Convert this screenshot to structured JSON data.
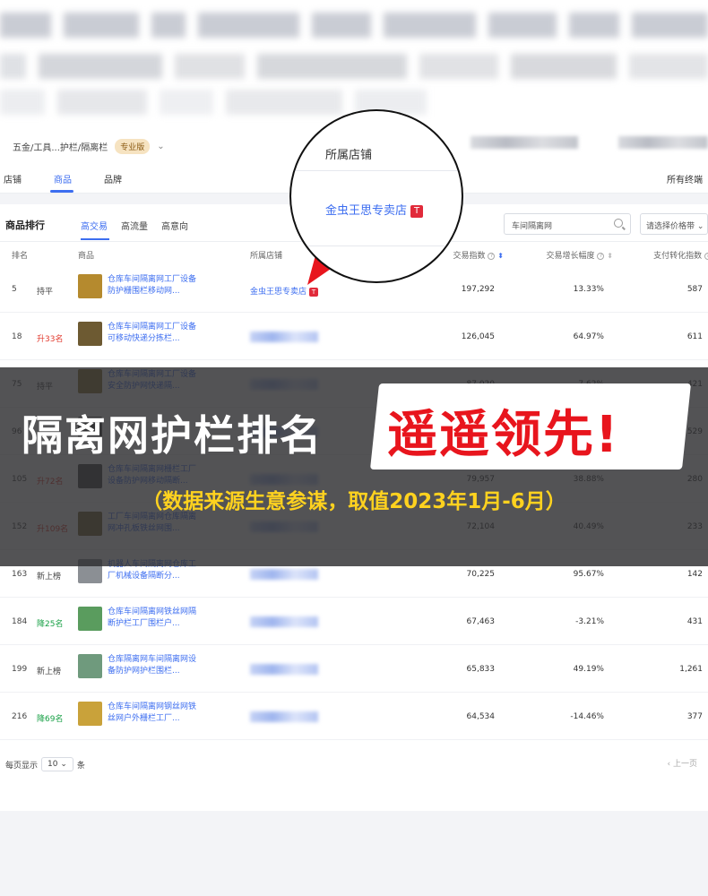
{
  "breadcrumb": {
    "path": "五金/工具...护栏/隔离栏",
    "edition": "专业版"
  },
  "top_nav": {
    "items": [
      "店铺",
      "商品",
      "品牌"
    ],
    "active": "商品",
    "right_item": "所有终端"
  },
  "section": {
    "title": "商品排行",
    "tabs": [
      "高交易",
      "高流量",
      "高意向"
    ],
    "active_tab": "高交易",
    "search_value": "车间隔离网",
    "select_value": "请选择价格带"
  },
  "table": {
    "headers": {
      "rank": "排名",
      "product": "商品",
      "shop": "所属店铺",
      "trade_index": "交易指数",
      "growth": "交易增长幅度",
      "conversion": "支付转化指数"
    },
    "rows": [
      {
        "rank": "5",
        "change": "持平",
        "trend": "flat",
        "name": "仓库车间隔离网工厂设备防护栅围栏移动网...",
        "shop": "金虫王思专卖店",
        "shop_visible": true,
        "trade_index": "197,292",
        "growth": "13.33%",
        "conversion": "587",
        "thumb_color": "#b58a2e"
      },
      {
        "rank": "18",
        "change": "升33名",
        "trend": "up",
        "name": "仓库车间隔离网工厂设备可移动快递分拣栏...",
        "shop": "",
        "shop_visible": false,
        "trade_index": "126,045",
        "growth": "64.97%",
        "conversion": "611",
        "thumb_color": "#6d5a32"
      },
      {
        "rank": "75",
        "change": "持平",
        "trend": "flat",
        "name": "仓库车间隔离网工厂设备安全防护网快递隔...",
        "shop": "",
        "shop_visible": false,
        "trade_index": "87,020",
        "growth": "7.62%",
        "conversion": "421",
        "thumb_color": "#8e7d3a"
      },
      {
        "rank": "96",
        "change": "",
        "trend": "flat",
        "name": "",
        "shop": "",
        "shop_visible": false,
        "trade_index": "",
        "growth": "",
        "conversion": "529",
        "thumb_color": "#555555"
      },
      {
        "rank": "105",
        "change": "升72名",
        "trend": "up",
        "name": "仓库车间隔离网栅栏工厂设备防护网移动隔断...",
        "shop": "",
        "shop_visible": false,
        "trade_index": "79,957",
        "growth": "38.88%",
        "conversion": "280",
        "thumb_color": "#4a4a4a"
      },
      {
        "rank": "152",
        "change": "升109名",
        "trend": "up",
        "name": "工厂车间隔离网仓库隔离网冲孔板铁丝网围...",
        "shop": "",
        "shop_visible": false,
        "trade_index": "72,104",
        "growth": "40.49%",
        "conversion": "233",
        "thumb_color": "#7a6a3a"
      },
      {
        "rank": "163",
        "change": "新上榜",
        "trend": "flat",
        "name": "机器人车间隔离网仓库工厂机械设备隔断分...",
        "shop": "",
        "shop_visible": false,
        "trade_index": "70,225",
        "growth": "95.67%",
        "conversion": "142",
        "thumb_color": "#8b8f94"
      },
      {
        "rank": "184",
        "change": "降25名",
        "trend": "down",
        "name": "仓库车间隔离网铁丝网隔断护栏工厂围栏户...",
        "shop": "",
        "shop_visible": false,
        "trade_index": "67,463",
        "growth": "-3.21%",
        "conversion": "431",
        "thumb_color": "#5a9c5e"
      },
      {
        "rank": "199",
        "change": "新上榜",
        "trend": "flat",
        "name": "仓库隔离网车间隔离网设备防护网护栏围栏...",
        "shop": "",
        "shop_visible": false,
        "trade_index": "65,833",
        "growth": "49.19%",
        "conversion": "1,261",
        "thumb_color": "#6f9a7d"
      },
      {
        "rank": "216",
        "change": "降69名",
        "trend": "down",
        "name": "仓库车间隔离网钢丝网铁丝网户外栅栏工厂...",
        "shop": "",
        "shop_visible": false,
        "trade_index": "64,534",
        "growth": "-14.46%",
        "conversion": "377",
        "thumb_color": "#c9a23a"
      }
    ]
  },
  "pager": {
    "per_page_label": "每页显示",
    "per_page": "10",
    "unit": "条",
    "prev": "‹ 上一页"
  },
  "magnifier": {
    "header": "所属店铺",
    "shop": "金虫王思专卖店",
    "badge": "T"
  },
  "banner": {
    "main": "隔离网护栏排名",
    "highlight": "遥遥领先!",
    "sub": "（数据来源生意参谋，取值2023年1月-6月）"
  },
  "colors": {
    "accent": "#3d6ef0",
    "up": "#e23a2e",
    "down": "#17a045",
    "highlight": "#e8151d",
    "sub": "#ffd21f"
  }
}
